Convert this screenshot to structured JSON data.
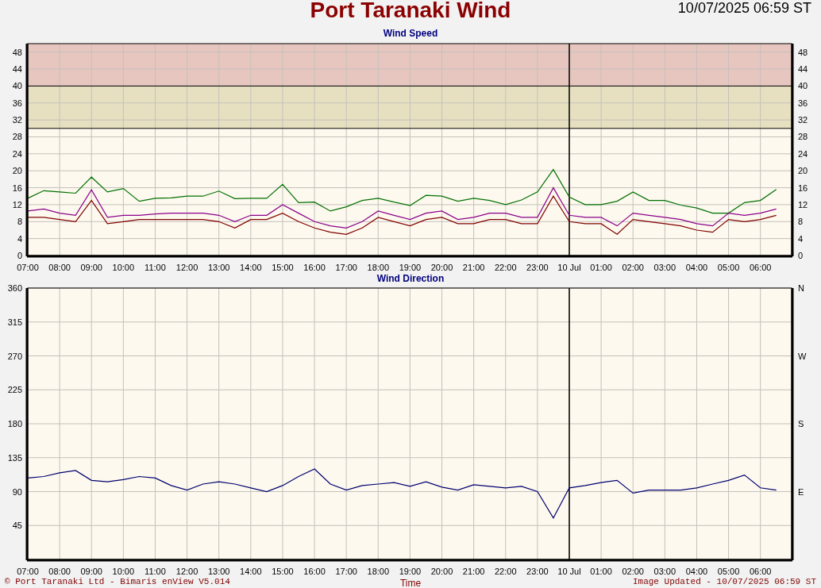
{
  "header": {
    "title": "Port Taranaki Wind",
    "timestamp": "10/07/2025 06:59 ST"
  },
  "speed_chart": {
    "chart_data": {
      "type": "line",
      "title": "Wind Speed",
      "ylim": [
        0,
        50
      ],
      "categories": [
        "07:00",
        null,
        "08:00",
        null,
        "09:00",
        null,
        "10:00",
        null,
        "11:00",
        null,
        "12:00",
        null,
        "13:00",
        null,
        "14:00",
        null,
        "15:00",
        null,
        "16:00",
        null,
        "17:00",
        null,
        "18:00",
        null,
        "19:00",
        null,
        "20:00",
        null,
        "21:00",
        null,
        "22:00",
        null,
        "23:00",
        null,
        "10 Jul",
        null,
        "01:00",
        null,
        "02:00",
        null,
        "03:00",
        null,
        "04:00",
        null,
        "05:00",
        null,
        "06:00",
        null
      ],
      "yticks": [
        0,
        4,
        8,
        12,
        16,
        20,
        24,
        28,
        32,
        36,
        40,
        44,
        48
      ],
      "y2ticks": [
        0,
        4,
        8,
        12,
        16,
        20,
        24,
        28,
        32,
        36,
        40,
        44,
        48
      ],
      "series": [
        {
          "color": "#007000",
          "values": [
            13.5,
            15.3,
            15,
            14.7,
            18.5,
            15,
            15.8,
            12.8,
            13.5,
            13.6,
            14,
            14,
            15.2,
            13.4,
            13.5,
            13.5,
            16.8,
            12.5,
            12.6,
            10.5,
            11.5,
            13,
            13.5,
            12.6,
            11.8,
            14.2,
            14,
            12.8,
            13.5,
            13,
            12,
            13.1,
            15,
            20.3,
            13.8,
            12,
            12,
            12.8,
            15,
            13,
            13,
            11.9,
            11.2,
            10,
            10,
            12.5,
            13,
            15.6
          ]
        },
        {
          "color": "#8b008b",
          "values": [
            10.5,
            11,
            10,
            9.5,
            15.5,
            9,
            9.5,
            9.5,
            9.8,
            10,
            10,
            10,
            9.5,
            8,
            9.5,
            9.5,
            12,
            10,
            8,
            7,
            6.5,
            8,
            10.5,
            9.5,
            8.5,
            10,
            10.5,
            8.5,
            9,
            10,
            10,
            9,
            9,
            16,
            9.5,
            9,
            9,
            7,
            10,
            9.5,
            9,
            8.5,
            7.5,
            7,
            10,
            9.5,
            10,
            11
          ]
        },
        {
          "color": "#800000",
          "values": [
            9,
            9,
            8.5,
            8,
            13,
            7.5,
            8,
            8.5,
            8.5,
            8.5,
            8.5,
            8.5,
            8,
            6.5,
            8.5,
            8.5,
            10,
            8,
            6.5,
            5.5,
            5,
            6.5,
            9,
            8,
            7,
            8.5,
            9,
            7.5,
            7.5,
            8.5,
            8.5,
            7.5,
            7.5,
            14,
            8,
            7.5,
            7.5,
            5,
            8.5,
            8,
            7.5,
            7,
            6,
            5.5,
            8.5,
            8,
            8.5,
            9.5
          ]
        }
      ],
      "y2lim": [
        0,
        50
      ],
      "grid": true,
      "bands": [
        {
          "axis": "y",
          "from": 40,
          "to": 50,
          "color": "#e8c6c0"
        },
        {
          "axis": "y",
          "from": 30,
          "to": 40,
          "color": "#e6e0c0"
        }
      ],
      "ref_lines": [
        {
          "axis": "y",
          "value": 40
        },
        {
          "axis": "y",
          "value": 30
        },
        {
          "axis": "x",
          "value": "10 Jul"
        }
      ]
    }
  },
  "direction_chart": {
    "chart_data": {
      "type": "line",
      "title": "Wind Direction",
      "xlabel": "Time",
      "ylim": [
        0,
        360
      ],
      "categories": [
        "07:00",
        null,
        "08:00",
        null,
        "09:00",
        null,
        "10:00",
        null,
        "11:00",
        null,
        "12:00",
        null,
        "13:00",
        null,
        "14:00",
        null,
        "15:00",
        null,
        "16:00",
        null,
        "17:00",
        null,
        "18:00",
        null,
        "19:00",
        null,
        "20:00",
        null,
        "21:00",
        null,
        "22:00",
        null,
        "23:00",
        null,
        "10 Jul",
        null,
        "01:00",
        null,
        "02:00",
        null,
        "03:00",
        null,
        "04:00",
        null,
        "05:00",
        null,
        "06:00",
        null
      ],
      "yticks": [
        45,
        90,
        135,
        180,
        225,
        270,
        315,
        360
      ],
      "grid": true,
      "series": [
        {
          "color": "#000070",
          "values": [
            108,
            110,
            115,
            118,
            105,
            103,
            106,
            110,
            108,
            98,
            92,
            100,
            103,
            100,
            95,
            90,
            98,
            110,
            120,
            100,
            92,
            98,
            100,
            102,
            97,
            103,
            96,
            92,
            99,
            97,
            95,
            97,
            90,
            55,
            95,
            98,
            102,
            105,
            88,
            92,
            92,
            92,
            95,
            100,
            105,
            112,
            95,
            92
          ]
        }
      ],
      "ref_lines": [
        {
          "axis": "x",
          "value": "10 Jul"
        }
      ]
    },
    "compass_labels": [
      "N",
      "W",
      "S",
      "E"
    ]
  },
  "footer": {
    "copyright": "© Port Taranaki Ltd - Bimaris enView V5.014",
    "updated": "Image Updated - 10/07/2025 06:59 ST"
  }
}
